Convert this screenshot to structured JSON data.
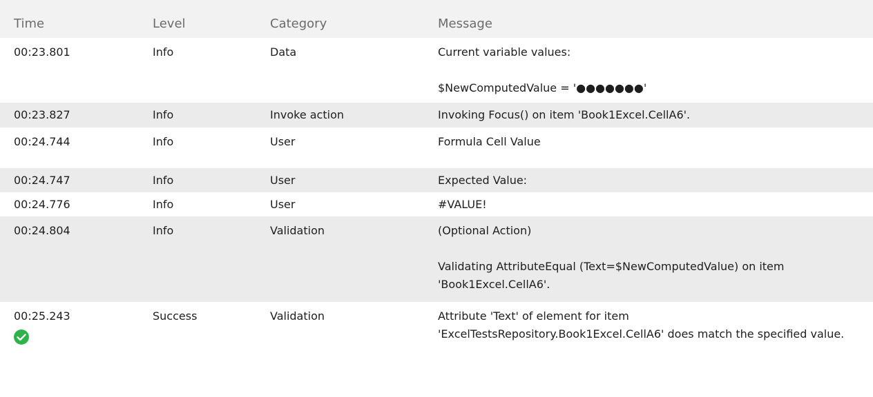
{
  "columns": {
    "time": "Time",
    "level": "Level",
    "category": "Category",
    "message": "Message"
  },
  "rows": [
    {
      "time": "00:23.801",
      "level": "Info",
      "category": "Data",
      "message_lines": [
        "Current variable values:",
        "$NewComputedValue = '●●●●●●●'"
      ]
    },
    {
      "time": "00:23.827",
      "level": "Info",
      "category": "Invoke action",
      "message_lines": [
        "Invoking Focus() on item 'Book1Excel.CellA6'."
      ]
    },
    {
      "time": "00:24.744",
      "level": "Info",
      "category": "User",
      "message_lines": [
        "Formula Cell Value"
      ]
    },
    {
      "time": "00:24.747",
      "level": "Info",
      "category": "User",
      "message_lines": [
        "Expected Value:"
      ]
    },
    {
      "time": "00:24.776",
      "level": "Info",
      "category": "User",
      "message_lines": [
        "#VALUE!"
      ]
    },
    {
      "time": "00:24.804",
      "level": "Info",
      "category": "Validation",
      "message_lines": [
        "(Optional Action)",
        "Validating AttributeEqual (Text=$NewComputedValue) on item 'Book1Excel.CellA6'."
      ]
    },
    {
      "time": "00:25.243",
      "level": "Success",
      "category": "Validation",
      "message_lines": [
        "Attribute 'Text' of element for item 'ExcelTestsRepository.Book1Excel.CellA6' does match the specified value."
      ],
      "icon": "success-check-icon"
    }
  ],
  "colors": {
    "header_bg": "#f2f2f2",
    "row_shade": "#ebebeb",
    "success_green": "#2db34a"
  }
}
